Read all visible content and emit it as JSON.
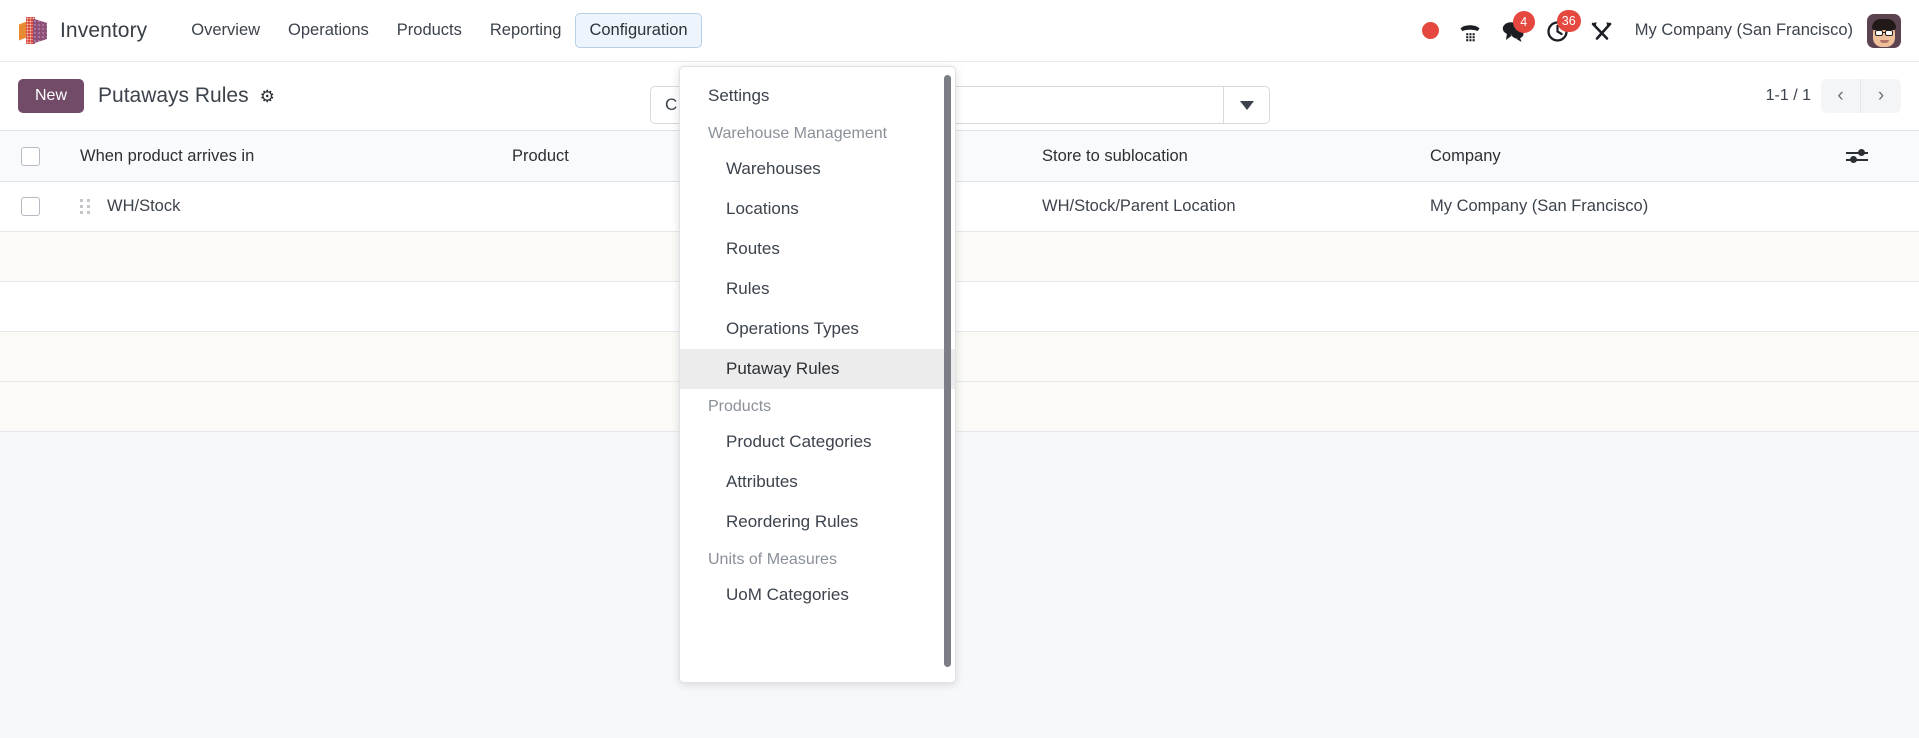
{
  "navbar": {
    "logo_icon": "odoo-cube-icon",
    "app_name": "Inventory",
    "menu_items": [
      {
        "label": "Overview",
        "active": false
      },
      {
        "label": "Operations",
        "active": false
      },
      {
        "label": "Products",
        "active": false
      },
      {
        "label": "Reporting",
        "active": false
      },
      {
        "label": "Configuration",
        "active": true
      }
    ],
    "system_icons": [
      {
        "name": "recording-dot-icon",
        "badge": null
      },
      {
        "name": "phone-dialpad-icon",
        "badge": null
      },
      {
        "name": "messages-icon",
        "badge": "4"
      },
      {
        "name": "activity-clock-icon",
        "badge": "36"
      },
      {
        "name": "tools-icon",
        "badge": null
      }
    ],
    "company": "My Company (San Francisco)",
    "avatar_icon": "user-avatar"
  },
  "control_panel": {
    "new_button": "New",
    "breadcrumb": "Putaways Rules",
    "settings_gear_icon": "gear-icon",
    "search": {
      "value": "C",
      "placeholder": "",
      "dropdown_icon": "chevron-down-icon"
    },
    "pager": {
      "count": "1-1 / 1",
      "previous_icon": "‹",
      "next_icon": "›"
    }
  },
  "list": {
    "columns": [
      "When product arrives in",
      "Product",
      "Store to sublocation",
      "Company"
    ],
    "options_icon": "column-options-icon",
    "rows": [
      {
        "arrives_in": "WH/Stock",
        "product": "",
        "sublocation": "WH/Stock/Parent Location",
        "company": "My Company (San Francisco)"
      }
    ],
    "empty_rows": 4
  },
  "configuration_menu": {
    "entries": [
      {
        "type": "item",
        "label": "Settings",
        "selected": false
      },
      {
        "type": "section",
        "label": "Warehouse Management"
      },
      {
        "type": "sub",
        "label": "Warehouses",
        "selected": false
      },
      {
        "type": "sub",
        "label": "Locations",
        "selected": false
      },
      {
        "type": "sub",
        "label": "Routes",
        "selected": false
      },
      {
        "type": "sub",
        "label": "Rules",
        "selected": false
      },
      {
        "type": "sub",
        "label": "Operations Types",
        "selected": false
      },
      {
        "type": "sub",
        "label": "Putaway Rules",
        "selected": true
      },
      {
        "type": "section",
        "label": "Products"
      },
      {
        "type": "sub",
        "label": "Product Categories",
        "selected": false
      },
      {
        "type": "sub",
        "label": "Attributes",
        "selected": false
      },
      {
        "type": "sub",
        "label": "Reordering Rules",
        "selected": false
      },
      {
        "type": "section",
        "label": "Units of Measures"
      },
      {
        "type": "sub",
        "label": "UoM Categories",
        "selected": false
      }
    ]
  },
  "colors": {
    "brand_purple": "#714b67",
    "accent_red": "#e4483f",
    "nav_active_bg": "#eef4fb",
    "nav_active_border": "#b8cfe8"
  }
}
